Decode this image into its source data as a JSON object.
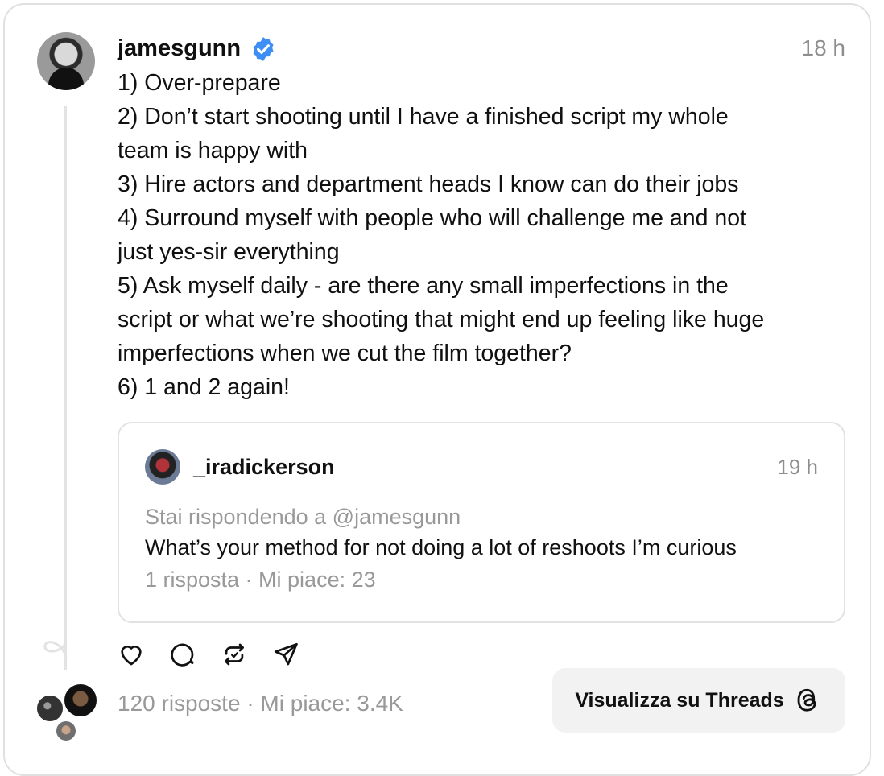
{
  "post": {
    "username": "jamesgunn",
    "time": "18 h",
    "lines": [
      "1) Over-prepare",
      "2) Don’t start shooting until I have a finished script my whole\nteam is happy with",
      "3) Hire actors and department heads I know can do their jobs",
      "4) Surround myself with people who will challenge me and not\njust yes-sir everything",
      "5) Ask myself daily - are there any small imperfections in the\nscript or what we’re shooting that might end up feeling like huge\nimperfections when we cut the film together?",
      "6) 1 and 2 again!"
    ],
    "stats": "120 risposte · Mi piace: 3.4K"
  },
  "quote": {
    "username": "_iradickerson",
    "time": "19 h",
    "replying_to": "Stai rispondendo a @jamesgunn",
    "text": "What’s your method for not doing a lot of reshoots I’m curious",
    "stats": "1 risposta · Mi piace: 23"
  },
  "button": {
    "label": "Visualizza su Threads"
  },
  "icons": {
    "verified": "verified-badge-icon",
    "like": "heart-icon",
    "reply": "comment-icon",
    "repost": "repost-icon",
    "share": "send-icon",
    "threads": "threads-logo-icon"
  },
  "colors": {
    "verified": "#3d8ff5",
    "muted": "#999999"
  }
}
